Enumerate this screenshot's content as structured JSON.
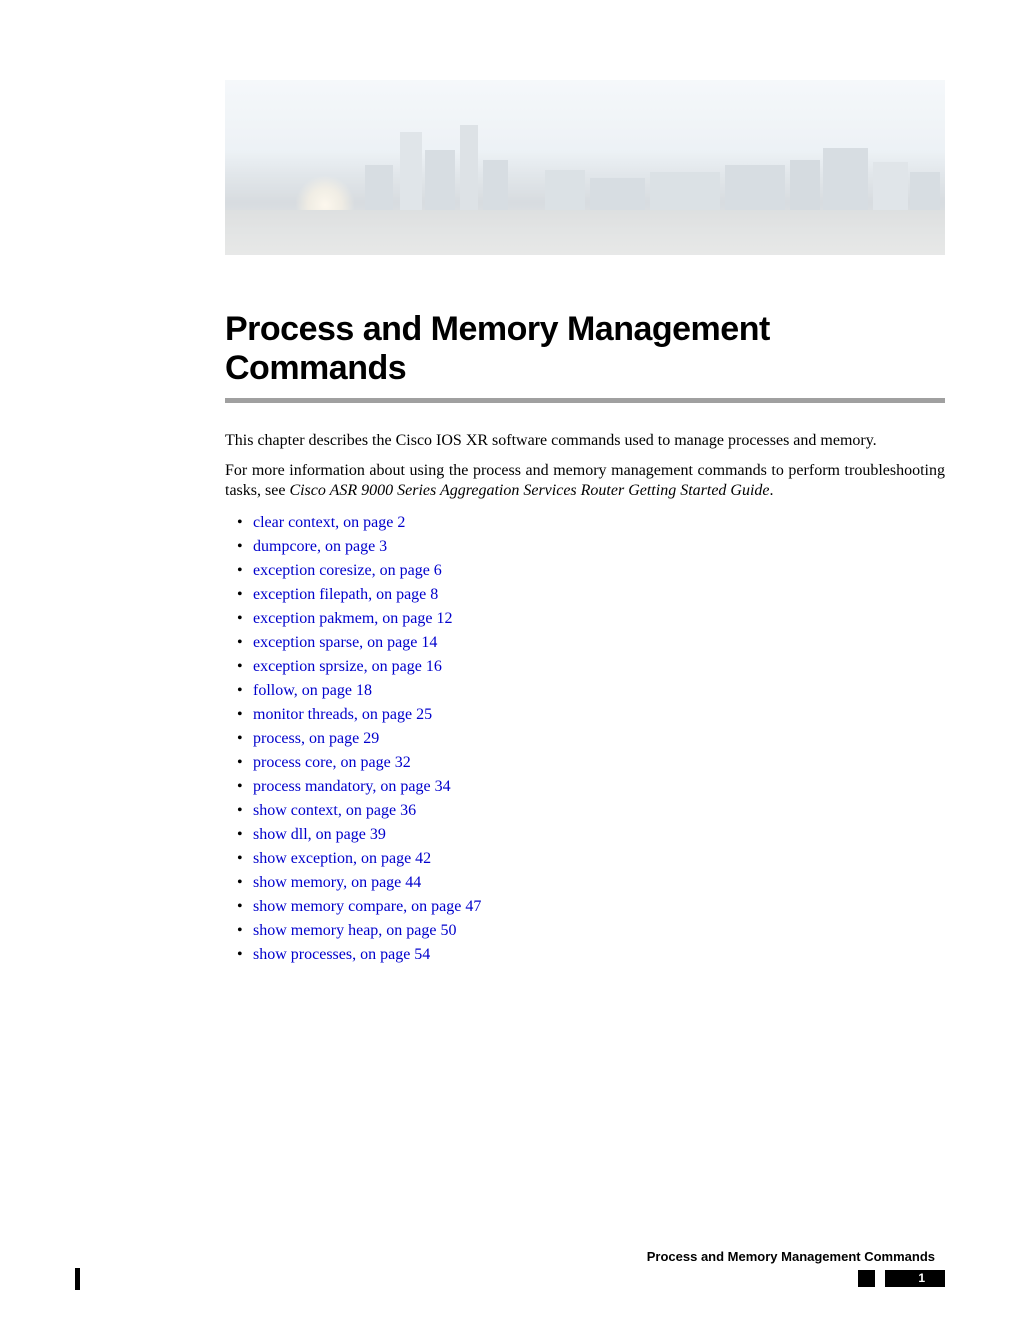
{
  "title": "Process and Memory Management Commands",
  "intro1": "This chapter describes the Cisco IOS XR software commands used to manage processes and memory.",
  "intro2a": "For more information about using the process and memory management commands to perform troubleshooting tasks, see ",
  "intro2b": "Cisco ASR 9000 Series Aggregation Services Router Getting Started Guide",
  "intro2c": ".",
  "toc": [
    "clear context, on page 2",
    "dumpcore, on page 3",
    "exception coresize, on page 6",
    "exception filepath, on page 8",
    "exception pakmem, on page 12",
    "exception sparse, on page 14",
    "exception sprsize, on page 16",
    "follow, on page 18",
    "monitor threads, on page 25",
    "process, on page 29",
    "process core, on page 32",
    "process mandatory, on page 34",
    "show context, on page 36",
    "show dll, on page 39",
    "show exception, on page 42",
    "show memory, on page 44",
    "show memory compare, on page 47",
    "show memory heap, on page 50",
    "show processes, on page 54"
  ],
  "footer": {
    "title": "Process and Memory Management Commands",
    "page": "1"
  }
}
